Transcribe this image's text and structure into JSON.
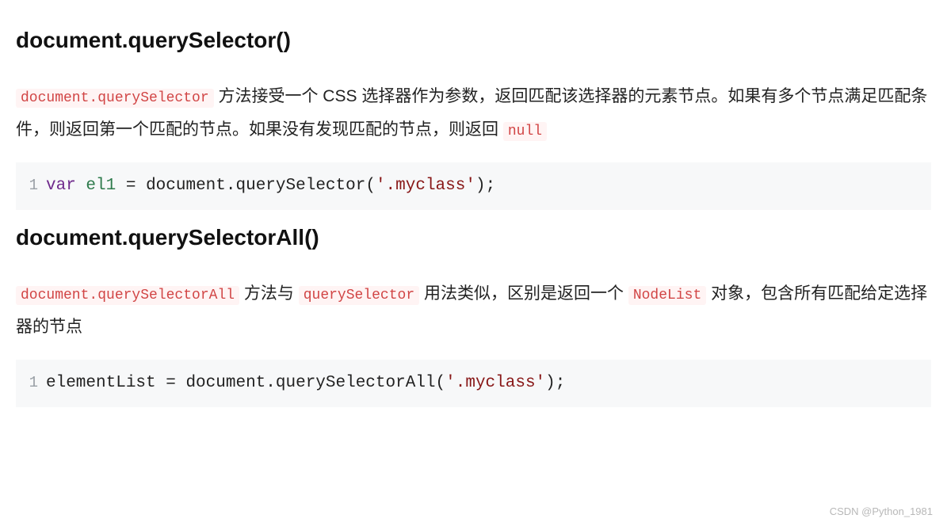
{
  "sections": [
    {
      "title": "document.querySelector()",
      "para": {
        "code0": "document.querySelector",
        "text1": " 方法接受一个 CSS 选择器作为参数，返回匹配该选择器的元素节点。如果有多个节点满足匹配条件，则返回第一个匹配的节点。如果没有发现匹配的节点，则返回 ",
        "code2": "null"
      },
      "code": {
        "lineno": "1",
        "kw": "var",
        "sp1": " ",
        "varname": "el1",
        "sp2": " ",
        "eq": "=",
        "sp3": " ",
        "obj": "document",
        "dot": ".",
        "method": "querySelector",
        "open": "(",
        "str": "'.myclass'",
        "close": ")",
        "semi": ";"
      }
    },
    {
      "title": "document.querySelectorAll()",
      "para": {
        "code0": "document.querySelectorAll",
        "text1": " 方法与 ",
        "code2": "querySelector",
        "text3": " 用法类似，区别是返回一个 ",
        "code4": "NodeList",
        "text5": " 对象，包含所有匹配给定选择器的节点"
      },
      "code": {
        "lineno": "1",
        "lhs": "elementList",
        "sp1": " ",
        "eq": "=",
        "sp2": " ",
        "obj": "document",
        "dot": ".",
        "method": "querySelectorAll",
        "open": "(",
        "str": "'.myclass'",
        "close": ")",
        "semi": ";"
      }
    }
  ],
  "watermark": "CSDN @Python_1981"
}
